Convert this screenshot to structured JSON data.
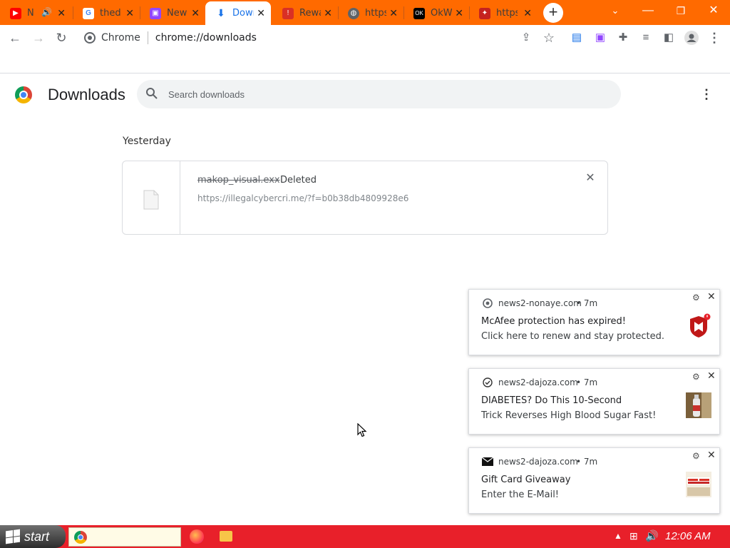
{
  "tabs": [
    {
      "title": "N",
      "favicon": "youtube-icon",
      "color": "#ff0000"
    },
    {
      "title": "thedi",
      "favicon": "google-icon",
      "color": "#4285f4"
    },
    {
      "title": "New",
      "favicon": "twitch-icon",
      "color": "#9146ff"
    },
    {
      "title": "Dowr",
      "favicon": "download-icon",
      "color": "#1a73e8"
    },
    {
      "title": "Rewa",
      "favicon": "reward-icon",
      "color": "#d93025"
    },
    {
      "title": "https",
      "favicon": "globe-icon",
      "color": "#5f6368"
    },
    {
      "title": "OkW",
      "favicon": "okw-icon",
      "color": "#000000"
    },
    {
      "title": "https",
      "favicon": "puzzle-icon",
      "color": "#c5221f"
    }
  ],
  "toolbar": {
    "site_label": "Chrome",
    "url": "chrome://downloads"
  },
  "downloads": {
    "title": "Downloads",
    "search_placeholder": "Search downloads",
    "date_label": "Yesterday",
    "item": {
      "file_name": "makop_visual.exx",
      "status": "Deleted",
      "url": "https://illegalcybercri.me/?f=b0b38db4809928e6"
    }
  },
  "notifications": [
    {
      "source": "news2-nonaye.com",
      "time": "• 7m",
      "title": "McAfee protection has expired!",
      "body": "Click here to renew and stay protected.",
      "icon": "chrome-icon",
      "image": "mcafee-shield"
    },
    {
      "source": "news2-dajoza.com",
      "time": "• 7m",
      "title": "DIABETES? Do This 10-Second",
      "body": "Trick Reverses High Blood Sugar Fast!",
      "icon": "check-circle-icon",
      "image": "bottle-photo"
    },
    {
      "source": "news2-dajoza.com",
      "time": "• 7m",
      "title": "Gift Card Giveaway",
      "body": "Enter the E-Mail!",
      "icon": "envelope-icon",
      "image": "gift-card-photo"
    }
  ],
  "taskbar": {
    "start_label": "start",
    "clock": "12:06 AM"
  },
  "colors": {
    "tabstrip": "#ff6a00",
    "taskbar": "#e8202a"
  }
}
